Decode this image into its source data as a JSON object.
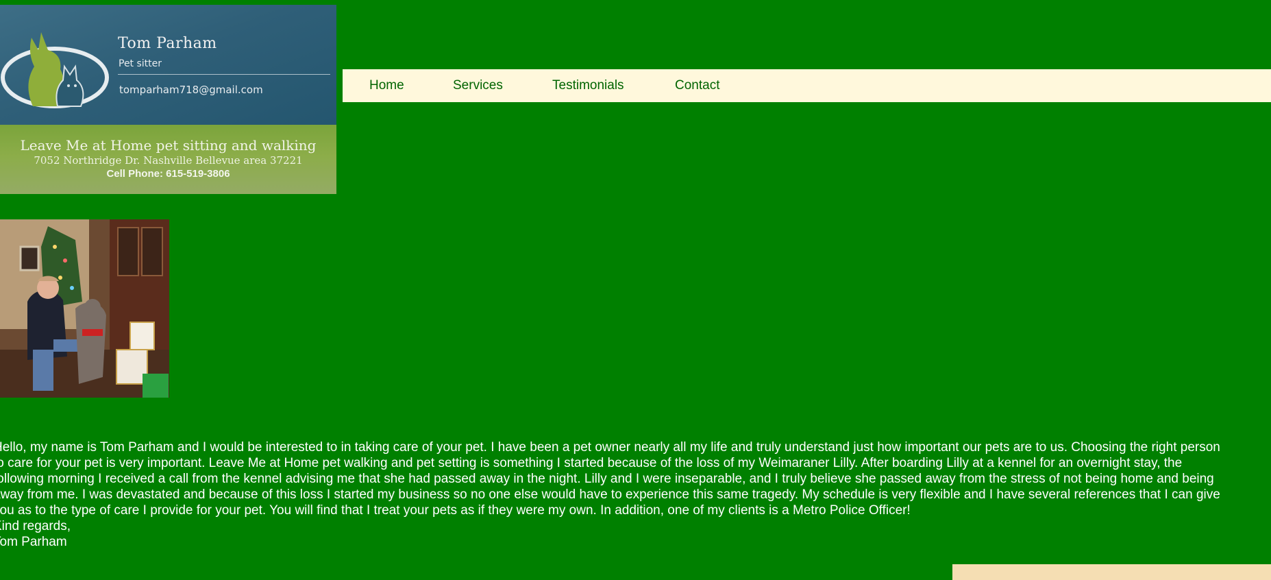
{
  "business_card": {
    "name": "Tom Parham",
    "role": "Pet sitter",
    "email": "tomparham718@gmail.com",
    "tagline": "Leave Me at Home pet sitting and walking",
    "address": "7052 Northridge Dr. Nashville  Bellevue area 37221",
    "phone": "Cell Phone: 615-519-3806",
    "colors": {
      "top": "#2f5f78",
      "bottom": "#8cad49",
      "logo": "#8fae3a"
    }
  },
  "nav": {
    "items": [
      {
        "label": "Home"
      },
      {
        "label": "Services"
      },
      {
        "label": "Testimonials"
      },
      {
        "label": "Contact"
      }
    ]
  },
  "intro": {
    "lines": [
      "Hello, my name is Tom Parham and I would be interested to in taking care of your pet. I have been a pet owner nearly all my life and truly understand just how important our pets are to us. Choosing the right person",
      "to care for your pet is very important. Leave Me at Home pet walking and pet setting is something I started because of the loss of my Weimaraner Lilly. After boarding Lilly at a kennel for an overnight stay, the",
      "following morning I received a call from the kennel advising me that she had passed away in the night. Lilly and I were inseparable, and I truly believe she passed away from the stress of not being home and being",
      "away from me. I was devastated and because of this loss I started my business so no one else would have to experience this same tragedy. My schedule is very flexible and I have several references that I can give",
      "you as to the type of care I provide for your pet. You will find that I treat your pets as if they were my own. In addition, one of my clients is a Metro Police Officer!",
      "Kind regards,",
      "Tom Parham"
    ]
  },
  "colors": {
    "page_background": "#008000",
    "nav_background": "#fff8dc",
    "nav_text": "#006400",
    "body_text": "#ffffff",
    "footer_box": "#f5deb3"
  }
}
